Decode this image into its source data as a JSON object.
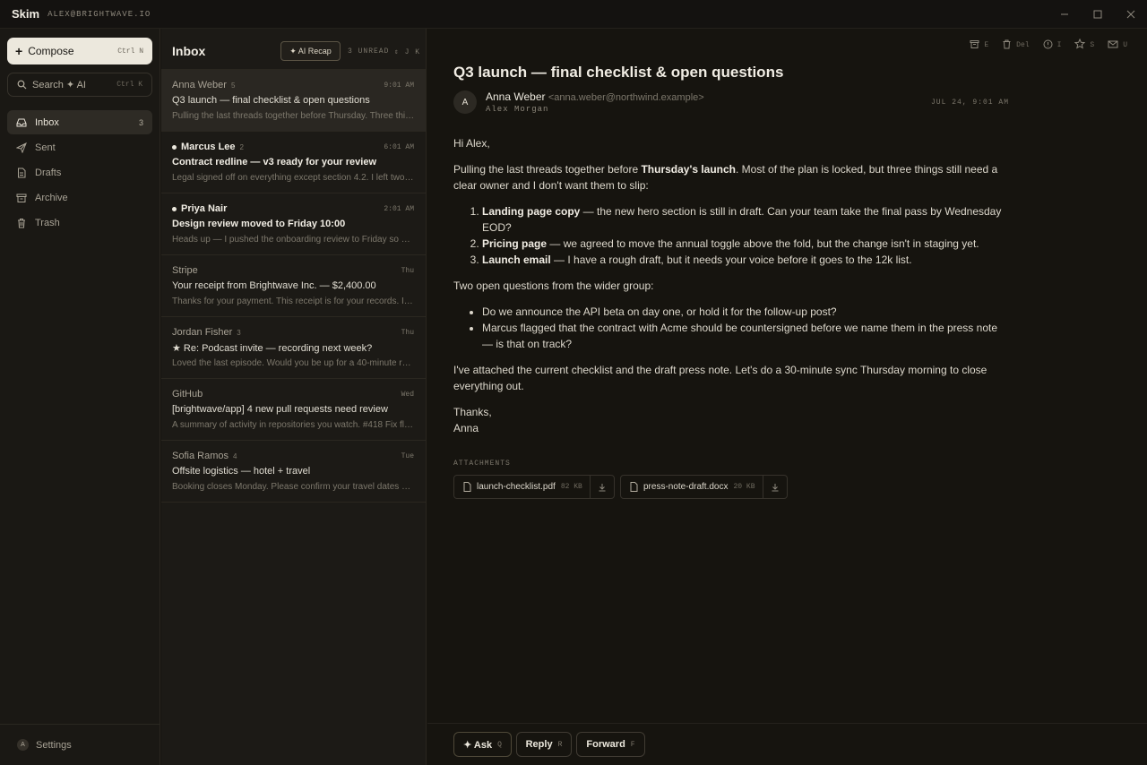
{
  "app": {
    "name": "Skim",
    "account": "ALEX@BRIGHTWAVE.IO"
  },
  "sidebar": {
    "compose": {
      "label": "Compose",
      "shortcut": "Ctrl N"
    },
    "search": {
      "label": "Search ✦ AI",
      "shortcut": "Ctrl K"
    },
    "items": [
      {
        "label": "Inbox",
        "count": "3",
        "icon": "inbox-icon"
      },
      {
        "label": "Sent",
        "count": "",
        "icon": "send-icon"
      },
      {
        "label": "Drafts",
        "count": "",
        "icon": "draft-icon"
      },
      {
        "label": "Archive",
        "count": "",
        "icon": "archive-icon"
      },
      {
        "label": "Trash",
        "count": "",
        "icon": "trash-icon"
      }
    ],
    "settings": {
      "avatar": "A",
      "label": "Settings"
    }
  },
  "list": {
    "title": "Inbox",
    "recap_label": "✦ AI Recap",
    "unread": "3 UNREAD",
    "nav_keys": "J K",
    "messages": [
      {
        "sender": "Anna Weber",
        "thread": "5",
        "time": "9:01 AM",
        "subject": "Q3 launch — final checklist & open questions",
        "preview": "Pulling the last threads together before Thursday. Three thi…"
      },
      {
        "sender": "Marcus Lee",
        "thread": "2",
        "time": "6:01 AM",
        "subject": "Contract redline — v3 ready for your review",
        "preview": "Legal signed off on everything except section 4.2. I left two …"
      },
      {
        "sender": "Priya Nair",
        "thread": "",
        "time": "2:01 AM",
        "subject": "Design review moved to Friday 10:00",
        "preview": "Heads up — I pushed the onboarding review to Friday so e…"
      },
      {
        "sender": "Stripe",
        "thread": "",
        "time": "Thu",
        "subject": "Your receipt from Brightwave Inc. — $2,400.00",
        "preview": "Thanks for your payment. This receipt is for your records. I…"
      },
      {
        "sender": "Jordan Fisher",
        "thread": "3",
        "time": "Thu",
        "subject": "★ Re: Podcast invite — recording next week?",
        "preview": "Loved the last episode. Would you be up for a 40-minute re…"
      },
      {
        "sender": "GitHub",
        "thread": "",
        "time": "Wed",
        "subject": "[brightwave/app] 4 new pull requests need review",
        "preview": "A summary of activity in repositories you watch. #418 Fix fl…"
      },
      {
        "sender": "Sofia Ramos",
        "thread": "4",
        "time": "Tue",
        "subject": "Offsite logistics — hotel + travel",
        "preview": "Booking closes Monday. Please confirm your travel dates s…"
      }
    ]
  },
  "toolbar": {
    "archive_key": "E",
    "delete_key": "Del",
    "snooze_key": "I",
    "star_key": "S",
    "unread_key": "U"
  },
  "email": {
    "subject": "Q3 launch — final checklist & open questions",
    "avatar": "A",
    "from_name": "Anna Weber",
    "from_email": "<anna.weber@northwind.example>",
    "to": "Alex Morgan",
    "date": "JUL 24, 9:01 AM",
    "greeting": "Hi Alex,",
    "p1_a": "Pulling the last threads together before ",
    "p1_b": "Thursday's launch",
    "p1_c": ". Most of the plan is locked, but three things still need a clear owner and I don't want them to slip:",
    "ol": [
      {
        "b": "Landing page copy",
        "t": " — the new hero section is still in draft. Can your team take the final pass by Wednesday EOD?"
      },
      {
        "b": "Pricing page",
        "t": " — we agreed to move the annual toggle above the fold, but the change isn't in staging yet."
      },
      {
        "b": "Launch email",
        "t": " — I have a rough draft, but it needs your voice before it goes to the 12k list."
      }
    ],
    "p2": "Two open questions from the wider group:",
    "ul": [
      "Do we announce the API beta on day one, or hold it for the follow-up post?",
      "Marcus flagged that the contract with Acme should be countersigned before we name them in the press note — is that on track?"
    ],
    "p3": "I've attached the current checklist and the draft press note. Let's do a 30-minute sync Thursday morning to close everything out.",
    "signoff": "Thanks,",
    "signature": "Anna",
    "attachments_title": "ATTACHMENTS",
    "attachments": [
      {
        "name": "launch-checklist.pdf",
        "size": "82 KB"
      },
      {
        "name": "press-note-draft.docx",
        "size": "20 KB"
      }
    ]
  },
  "actions": {
    "ask": {
      "label": "✦ Ask",
      "key": "Q"
    },
    "reply": {
      "label": "Reply",
      "key": "R"
    },
    "forward": {
      "label": "Forward",
      "key": "F"
    }
  }
}
